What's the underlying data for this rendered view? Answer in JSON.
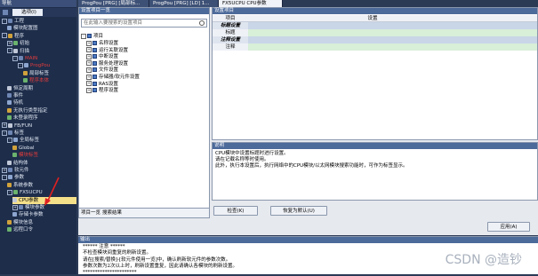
{
  "nav": {
    "header": "导航",
    "select_label": "选项(I)",
    "items": [
      {
        "label": "工程",
        "indent": 0,
        "exp": "-",
        "color": "#dfe6f2"
      },
      {
        "label": "模块配置图",
        "indent": 1,
        "exp": "",
        "color": "#dfe6f2"
      },
      {
        "label": "程序",
        "indent": 0,
        "exp": "-",
        "color": "#dfe6f2"
      },
      {
        "label": "初始",
        "indent": 1,
        "exp": "+",
        "color": "#dfe6f2"
      },
      {
        "label": "扫描",
        "indent": 1,
        "exp": "-",
        "color": "#dfe6f2"
      },
      {
        "label": "MAIN",
        "indent": 2,
        "exp": "-",
        "color": "#e23c3c"
      },
      {
        "label": "ProgPou",
        "indent": 3,
        "exp": "-",
        "color": "#e23c3c"
      },
      {
        "label": "局部标签",
        "indent": 4,
        "exp": "",
        "color": "#dfe6f2"
      },
      {
        "label": "程序本体",
        "indent": 4,
        "exp": "",
        "color": "#e23c3c"
      },
      {
        "label": "恒定周期",
        "indent": 1,
        "exp": "",
        "color": "#dfe6f2"
      },
      {
        "label": "事件",
        "indent": 1,
        "exp": "",
        "color": "#dfe6f2"
      },
      {
        "label": "待机",
        "indent": 1,
        "exp": "",
        "color": "#dfe6f2"
      },
      {
        "label": "无执行类型指定",
        "indent": 1,
        "exp": "",
        "color": "#dfe6f2"
      },
      {
        "label": "未登录程序",
        "indent": 1,
        "exp": "",
        "color": "#dfe6f2"
      },
      {
        "label": "FB/FUN",
        "indent": 0,
        "exp": "+",
        "color": "#dfe6f2"
      },
      {
        "label": "标签",
        "indent": 0,
        "exp": "-",
        "color": "#dfe6f2"
      },
      {
        "label": "全局标签",
        "indent": 1,
        "exp": "-",
        "color": "#dfe6f2"
      },
      {
        "label": "Global",
        "indent": 2,
        "exp": "",
        "color": "#dfe6f2"
      },
      {
        "label": "模块标签",
        "indent": 2,
        "exp": "",
        "color": "#e23c3c"
      },
      {
        "label": "结构体",
        "indent": 1,
        "exp": "",
        "color": "#dfe6f2"
      },
      {
        "label": "软元件",
        "indent": 0,
        "exp": "+",
        "color": "#dfe6f2"
      },
      {
        "label": "参数",
        "indent": 0,
        "exp": "-",
        "color": "#dfe6f2"
      },
      {
        "label": "系统参数",
        "indent": 1,
        "exp": "",
        "color": "#dfe6f2"
      },
      {
        "label": "FX5UCPU",
        "indent": 1,
        "exp": "-",
        "color": "#dfe6f2"
      },
      {
        "label": "CPU参数",
        "indent": 2,
        "exp": "",
        "color": "#000000",
        "highlight": true
      },
      {
        "label": "模块参数",
        "indent": 2,
        "exp": "+",
        "color": "#dfe6f2"
      },
      {
        "label": "存储卡参数",
        "indent": 2,
        "exp": "",
        "color": "#dfe6f2"
      },
      {
        "label": "模块信息",
        "indent": 1,
        "exp": "",
        "color": "#dfe6f2"
      },
      {
        "label": "远程口令",
        "indent": 1,
        "exp": "",
        "color": "#dfe6f2"
      }
    ]
  },
  "tabs": [
    {
      "label": "ProgPou [PRG] [局部标...",
      "active": false
    },
    {
      "label": "ProgPou [PRG] [LD] 1...",
      "active": false
    },
    {
      "label": "FX5UCPU CPU参数",
      "active": true
    }
  ],
  "left_panel": {
    "title": "设置项目一览",
    "search_placeholder": "在此输入要搜索的设置项目",
    "root": "项目",
    "items": [
      "名称设置",
      "运行关联设置",
      "中断设置",
      "服务处理设置",
      "文件设置",
      "存储器/软元件设置",
      "RAS设置",
      "程序设置"
    ],
    "tab_list": "项目一览",
    "tab_search": "搜索结果"
  },
  "grid": {
    "title": "设置项目",
    "col_item": "项目",
    "col_setting": "设置",
    "rows": [
      {
        "label": "标题设置",
        "bold": true
      },
      {
        "label": "标题",
        "bold": false
      },
      {
        "label": "注释设置",
        "bold": true
      },
      {
        "label": "注释",
        "bold": false
      }
    ]
  },
  "description": {
    "title": "说明",
    "text": "CPU模块中设置标题时进行设置。\n请在记载名称等时使用。\n此外，执行本设置后，执行网络中的CPU模块/以太网模块搜索功能时，可作为标签显示。"
  },
  "buttons": {
    "check": "检查(K)",
    "restore": "恢复为默认(U)",
    "apply": "应用(A)"
  },
  "output": {
    "title": "输出",
    "text": "****** 注意 ******\n不检查模块间重复的刷新设置。\n请在[搜索/替换]-[软元件使用一览]中，确认刷新软元件的参数次数。\n参数次数为2次以上时，刷新设置重复，因此请确认各模块的刷新设置。\n**********************"
  },
  "watermark": "CSDN @造钞"
}
